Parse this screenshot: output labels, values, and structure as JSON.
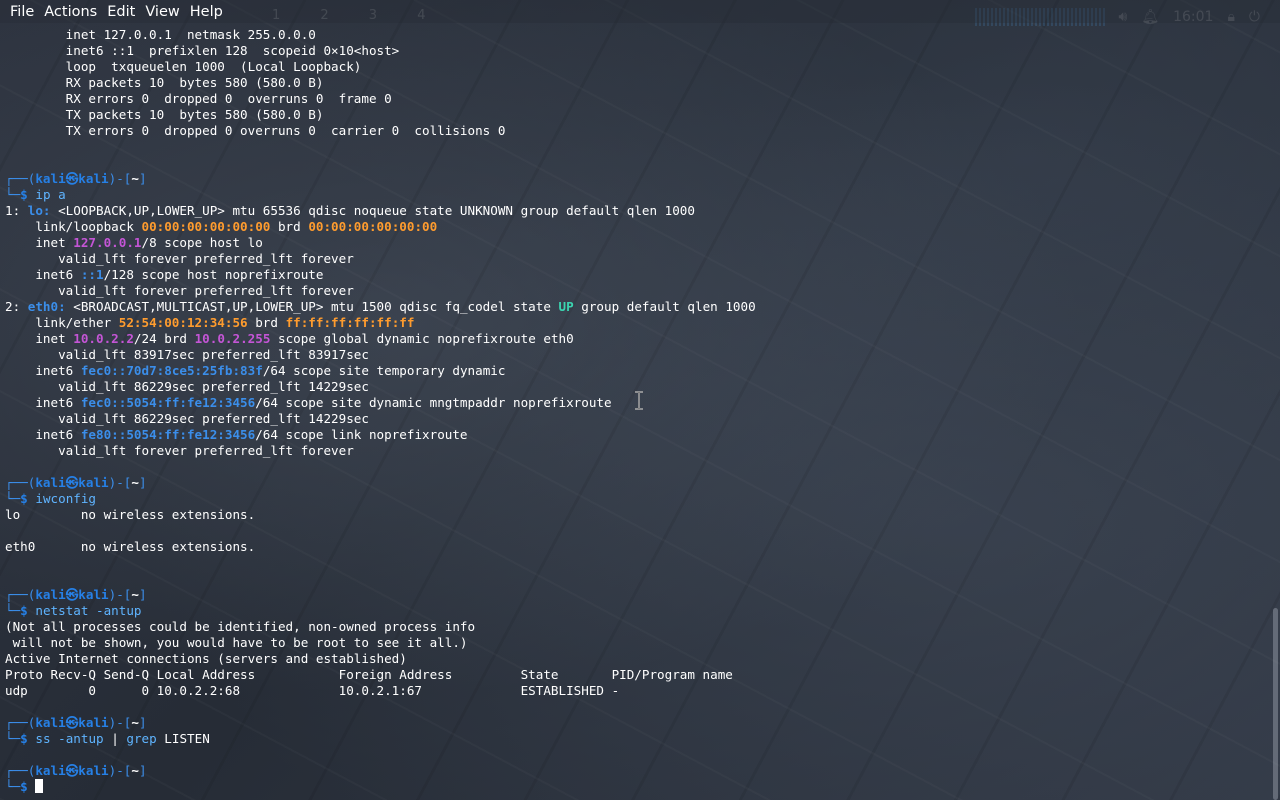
{
  "menubar": {
    "file": "File",
    "actions": "Actions",
    "edit": "Edit",
    "view": "View",
    "help": "Help"
  },
  "panel": {
    "workspaces": "1 2 3 4",
    "clock": "16:01"
  },
  "terminal": {
    "prompt": {
      "open": "┌──(",
      "user": "kali",
      "at": "㉿",
      "host": "kali",
      "mid": ")-[",
      "dir": "~",
      "close": "]",
      "arrow": "└─",
      "dollar": "$"
    },
    "lo_tail": [
      "        inet 127.0.0.1  netmask 255.0.0.0",
      "        inet6 ::1  prefixlen 128  scopeid 0×10<host>",
      "        loop  txqueuelen 1000  (Local Loopback)",
      "        RX packets 10  bytes 580 (580.0 B)",
      "        RX errors 0  dropped 0  overruns 0  frame 0",
      "        TX packets 10  bytes 580 (580.0 B)",
      "        TX errors 0  dropped 0 overruns 0  carrier 0  collisions 0"
    ],
    "cmd1": {
      "main": "ip",
      "args": " a"
    },
    "ip_a": {
      "lo_num": "1: ",
      "lo_name": "lo:",
      "lo_flags": " <LOOPBACK,UP,LOWER_UP> mtu 65536 qdisc noqueue state UNKNOWN group default qlen 1000",
      "lo_link_pre": "    link/loopback ",
      "lo_mac": "00:00:00:00:00:00",
      "brd": " brd ",
      "lo_brd": "00:00:00:00:00:00",
      "lo_inet_pre": "    inet ",
      "lo_inet": "127.0.0.1",
      "lo_inet_post": "/8 scope host lo",
      "valid_forever": "       valid_lft forever preferred_lft forever",
      "lo_inet6_pre": "    inet6 ",
      "lo_inet6": "::1",
      "lo_inet6_post": "/128 scope host noprefixroute",
      "eth_num": "2: ",
      "eth_name": "eth0:",
      "eth_flags_a": " <BROADCAST,MULTICAST,UP,LOWER_UP> mtu 1500 qdisc fq_codel state ",
      "eth_state": "UP",
      "eth_flags_b": " group default qlen 1000",
      "eth_link_pre": "    link/ether ",
      "eth_mac": "52:54:00:12:34:56",
      "eth_brd": "ff:ff:ff:ff:ff:ff",
      "eth_inet_pre": "    inet ",
      "eth_inet": "10.0.2.2",
      "eth_inet_mid": "/24 brd ",
      "eth_inet_brd": "10.0.2.255",
      "eth_inet_post": " scope global dynamic noprefixroute eth0",
      "eth_valid1": "       valid_lft 83917sec preferred_lft 83917sec",
      "eth_inet6a_pre": "    inet6 ",
      "eth_inet6a": "fec0::70d7:8ce5:25fb:83f",
      "eth_inet6a_post": "/64 scope site temporary dynamic",
      "eth_valid2": "       valid_lft 86229sec preferred_lft 14229sec",
      "eth_inet6b_pre": "    inet6 ",
      "eth_inet6b": "fec0::5054:ff:fe12:3456",
      "eth_inet6b_post": "/64 scope site dynamic mngtmpaddr noprefixroute",
      "eth_valid3": "       valid_lft 86229sec preferred_lft 14229sec",
      "eth_inet6c_pre": "    inet6 ",
      "eth_inet6c": "fe80::5054:ff:fe12:3456",
      "eth_inet6c_post": "/64 scope link noprefixroute",
      "eth_valid4": "       valid_lft forever preferred_lft forever"
    },
    "cmd2": {
      "main": "iwconfig",
      "args": ""
    },
    "iwconfig": [
      "lo        no wireless extensions.",
      "eth0      no wireless extensions."
    ],
    "cmd3": {
      "main": "netstat",
      "args": " -antup"
    },
    "netstat": [
      "(Not all processes could be identified, non-owned process info",
      " will not be shown, you would have to be root to see it all.)",
      "Active Internet connections (servers and established)",
      "Proto Recv-Q Send-Q Local Address           Foreign Address         State       PID/Program name",
      "udp        0      0 10.0.2.2:68             10.0.2.1:67             ESTABLISHED -"
    ],
    "cmd4": {
      "main": "ss",
      "args": " -antup ",
      "pipe": "|",
      "main2": " grep",
      "args2": " LISTEN"
    }
  }
}
